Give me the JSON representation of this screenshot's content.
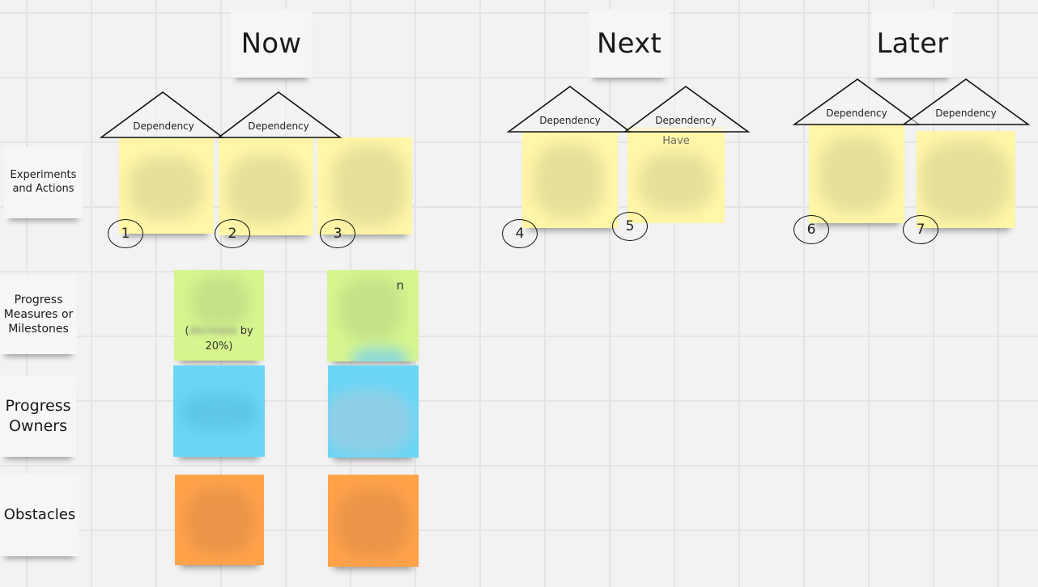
{
  "board": {
    "columns": [
      {
        "title": "Now"
      },
      {
        "title": "Next"
      },
      {
        "title": "Later"
      }
    ],
    "rows": [
      {
        "label": "Experiments and Actions"
      },
      {
        "label": "Progress Measures or Milestones"
      },
      {
        "label": "Progress Owners"
      },
      {
        "label": "Obstacles"
      }
    ],
    "dependency_label": "Dependency",
    "numbers": [
      "1",
      "2",
      "3",
      "4",
      "5",
      "6",
      "7"
    ],
    "stickies": {
      "action_5_visible_text": "Have",
      "measure_1_visible_text": "(decrease by 20%)",
      "measure_1_visible_line2": "20%)",
      "measure_1_visible_line1": "(d        by",
      "measure_2_visible_text": "n"
    },
    "colors": {
      "yellow": "#fff6a8",
      "green": "#d6f58e",
      "blue": "#6bd6f6",
      "orange": "#ffa24a",
      "canvas": "#f2f2f2"
    }
  }
}
